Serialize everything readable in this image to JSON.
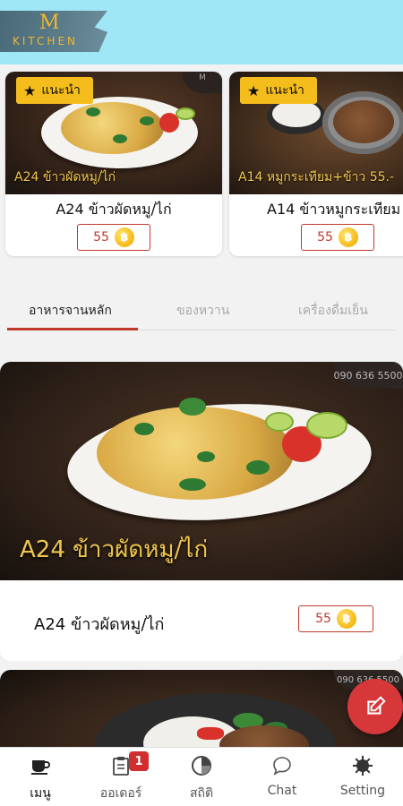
{
  "header": {
    "logo_letter": "M",
    "logo_text": "KITCHEN"
  },
  "recommended": {
    "badge_label": "แนะนำ",
    "items": [
      {
        "code_caption": "A24 ข้าวผัดหมู/ไก่",
        "name": "A24 ข้าวผัดหมู/ไก่",
        "price": "55",
        "watermark": "M"
      },
      {
        "code_caption": "A14 หมูกระเทียม+ข้าว  55.-",
        "name": "A14 ข้าวหมูกระเทียม",
        "price": "55"
      }
    ]
  },
  "tabs": [
    {
      "label": "อาหารจานหลัก",
      "active": true
    },
    {
      "label": "ของหวาน",
      "active": false
    },
    {
      "label": "เครื่องดื่มเย็น",
      "active": false
    }
  ],
  "feed": [
    {
      "image_caption": "A24 ข้าวผัดหมู/ไก่",
      "phone": "090 636 5500",
      "name": "A24 ข้าวผัดหมู/ไก่",
      "price": "55"
    },
    {
      "phone": "090 636 5500"
    }
  ],
  "currency_symbol": "฿",
  "bottom_nav": [
    {
      "label": "เมนู",
      "icon": "cup-icon",
      "active": true
    },
    {
      "label": "ออเดอร์",
      "icon": "clipboard-icon",
      "active": false,
      "badge": "1"
    },
    {
      "label": "สถิติ",
      "icon": "pie-chart-icon",
      "active": false
    },
    {
      "label": "Chat",
      "icon": "chat-bubble-icon",
      "active": false
    },
    {
      "label": "Setting",
      "icon": "gear-icon",
      "active": false
    }
  ],
  "colors": {
    "header_bg": "#9fe6f7",
    "accent_red": "#c0392b",
    "badge_yellow": "#f5bd1c",
    "coin_gold": "#f5b816"
  }
}
